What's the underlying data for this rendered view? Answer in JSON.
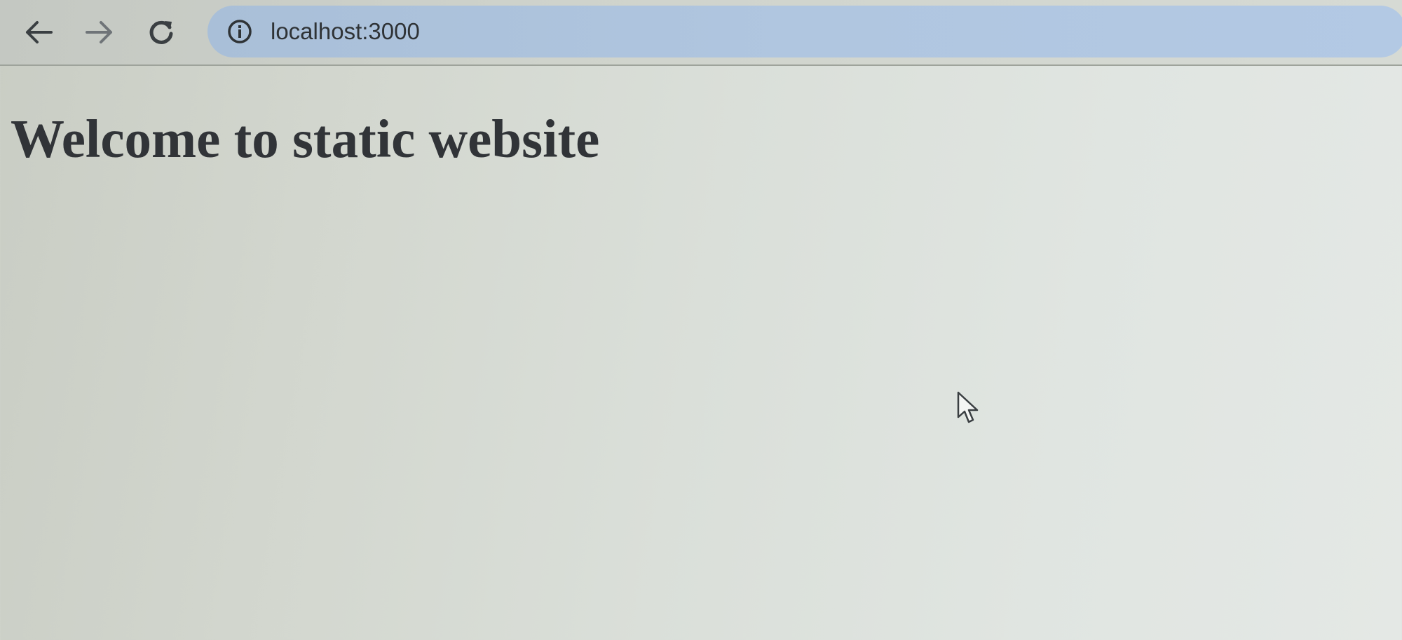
{
  "browser": {
    "url": "localhost:3000",
    "icons": {
      "back": "back-arrow-icon",
      "forward": "forward-arrow-icon",
      "reload": "reload-icon",
      "site_info": "info-circle-icon",
      "cursor": "mouse-pointer-icon"
    }
  },
  "page": {
    "heading": "Welcome to static website"
  },
  "colors": {
    "address_bar": "#b0c6e0",
    "heading_text": "#313438",
    "page_background": "#dadfd9"
  }
}
